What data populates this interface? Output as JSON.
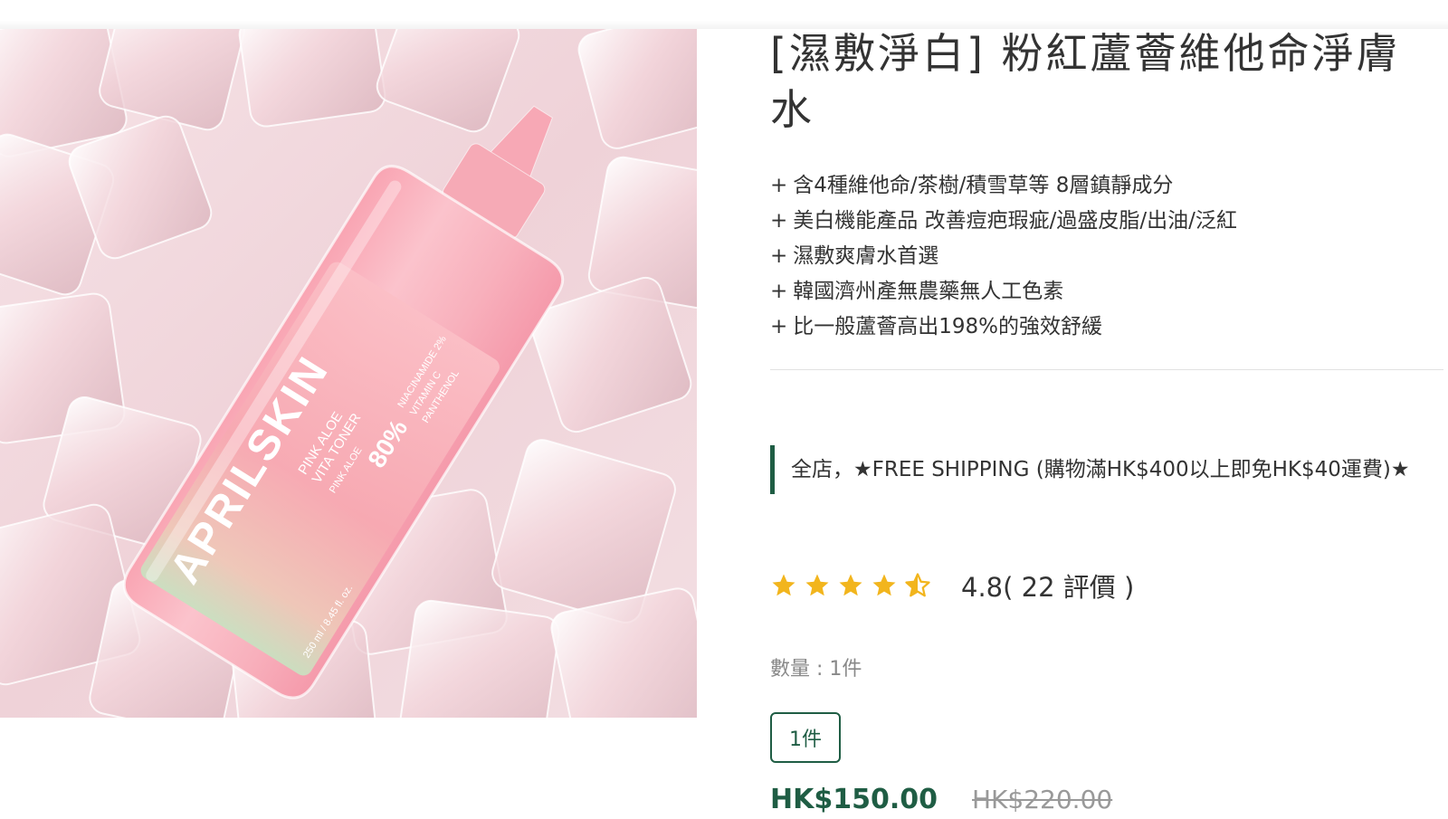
{
  "product": {
    "image_alt": "APRILSKIN Pink Aloe Vita Toner bottle on ice cubes",
    "bottle_text": {
      "brand": "APRILSKIN",
      "line1": "PINK ALOE",
      "line2": "VITA TONER",
      "line3": "PINK ALOE",
      "percent": "80%",
      "ingredient1": "NIACINAMIDE 2%",
      "ingredient2": "VITAMIN C",
      "ingredient3": "PANTHENOL",
      "volume": "250 ml / 8.45 fl. oz."
    },
    "title": "[濕敷淨白] 粉紅蘆薈維他命淨膚水",
    "features": [
      "含4種維他命/茶樹/積雪草等 8層鎮靜成分",
      "美白機能產品 改善痘疤瑕疵/過盛皮脂/出油/泛紅",
      "濕敷爽膚水首選",
      "韓國濟州產無農藥無人工色素",
      "比一般蘆薈高出198%的強效舒緩"
    ],
    "feature_prefix": "+",
    "promo": "全店，★FREE SHIPPING (購物滿HK$400以上即免HK$40運費)★",
    "rating": {
      "stars_value": 4.8,
      "stars_max": 5,
      "score_text": "4.8( 22 評價 )"
    },
    "quantity": {
      "label": "數量 : 1件",
      "options": [
        "1件"
      ],
      "selected": "1件"
    },
    "price": {
      "current": "HK$150.00",
      "original": "HK$220.00"
    }
  },
  "colors": {
    "brand_green": "#1f5d44",
    "star_gold": "#f2b51d",
    "text": "#333333",
    "muted": "#999999"
  },
  "icons": {
    "star": "star-icon",
    "half_star": "star-half-icon"
  }
}
